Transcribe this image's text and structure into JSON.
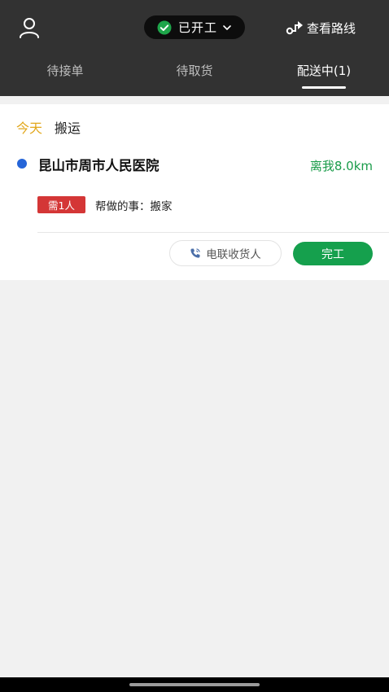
{
  "header": {
    "status_label": "已开工",
    "route_label": "查看路线",
    "icons": {
      "user": "user-icon",
      "status": "check-circle-icon",
      "status_dropdown": "chevron-down-icon",
      "route": "route-icon"
    },
    "colors": {
      "background": "#323232",
      "status_green": "#1ea54a"
    }
  },
  "tabs": [
    {
      "label": "待接单",
      "active": false
    },
    {
      "label": "待取货",
      "active": false
    },
    {
      "label": "配送中(1)",
      "active": true
    }
  ],
  "order": {
    "day": "今天",
    "category": "搬运",
    "address": "昆山市周市人民医院",
    "distance": "离我8.0km",
    "need_badge": "需1人",
    "help_text": "帮做的事：搬家",
    "call_label": "电联收货人",
    "done_label": "完工",
    "colors": {
      "day": "#e2a71c",
      "distance": "#1a9c4a",
      "badge": "#d43636",
      "done_button": "#15a04d",
      "location_dot": "#2565d8"
    }
  }
}
